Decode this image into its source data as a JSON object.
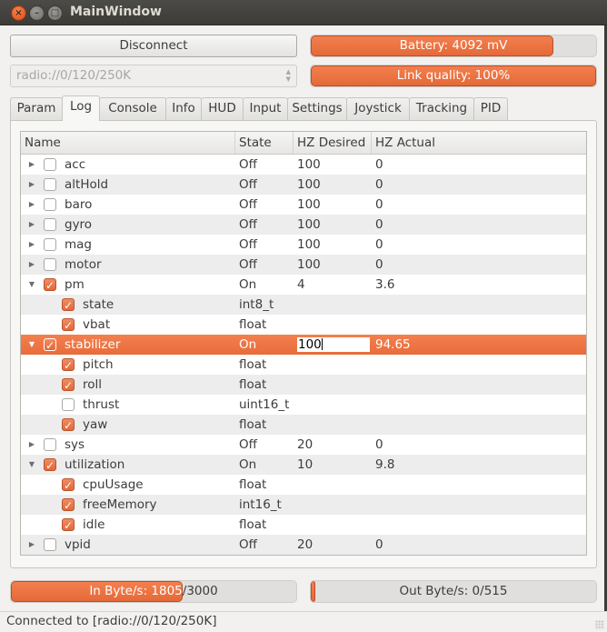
{
  "window": {
    "title": "MainWindow"
  },
  "toolbar": {
    "disconnect_label": "Disconnect",
    "uri_value": "radio://0/120/250K"
  },
  "battery": {
    "label": "Battery: 4092 mV",
    "fraction": 0.85
  },
  "link_quality": {
    "label": "Link quality: 100%",
    "fraction": 1.0
  },
  "tabs": [
    {
      "label": "Param",
      "active": false
    },
    {
      "label": "Log",
      "active": true
    },
    {
      "label": "Console",
      "active": false
    },
    {
      "label": "Info",
      "active": false
    },
    {
      "label": "HUD",
      "active": false
    },
    {
      "label": "Input",
      "active": false
    },
    {
      "label": "Settings",
      "active": false
    },
    {
      "label": "Joystick",
      "active": false
    },
    {
      "label": "Tracking",
      "active": false
    },
    {
      "label": "PID",
      "active": false
    }
  ],
  "log_tree": {
    "columns": [
      "Name",
      "State",
      "HZ Desired",
      "HZ Actual"
    ],
    "rows": [
      {
        "level": 0,
        "expander": "collapsed",
        "checked": false,
        "name": "acc",
        "state": "Off",
        "hz_desired": "100",
        "hz_actual": "0"
      },
      {
        "level": 0,
        "expander": "collapsed",
        "checked": false,
        "name": "altHold",
        "state": "Off",
        "hz_desired": "100",
        "hz_actual": "0"
      },
      {
        "level": 0,
        "expander": "collapsed",
        "checked": false,
        "name": "baro",
        "state": "Off",
        "hz_desired": "100",
        "hz_actual": "0"
      },
      {
        "level": 0,
        "expander": "collapsed",
        "checked": false,
        "name": "gyro",
        "state": "Off",
        "hz_desired": "100",
        "hz_actual": "0"
      },
      {
        "level": 0,
        "expander": "collapsed",
        "checked": false,
        "name": "mag",
        "state": "Off",
        "hz_desired": "100",
        "hz_actual": "0"
      },
      {
        "level": 0,
        "expander": "collapsed",
        "checked": false,
        "name": "motor",
        "state": "Off",
        "hz_desired": "100",
        "hz_actual": "0"
      },
      {
        "level": 0,
        "expander": "expanded",
        "checked": true,
        "name": "pm",
        "state": "On",
        "hz_desired": "4",
        "hz_actual": "3.6"
      },
      {
        "level": 1,
        "expander": "none",
        "checked": true,
        "name": "state",
        "state": "int8_t",
        "hz_desired": "",
        "hz_actual": ""
      },
      {
        "level": 1,
        "expander": "none",
        "checked": true,
        "name": "vbat",
        "state": "float",
        "hz_desired": "",
        "hz_actual": ""
      },
      {
        "level": 0,
        "expander": "expanded",
        "checked": true,
        "name": "stabilizer",
        "state": "On",
        "hz_desired": "100",
        "hz_actual": "94.65",
        "selected": true,
        "editing": true
      },
      {
        "level": 1,
        "expander": "none",
        "checked": true,
        "name": "pitch",
        "state": "float",
        "hz_desired": "",
        "hz_actual": ""
      },
      {
        "level": 1,
        "expander": "none",
        "checked": true,
        "name": "roll",
        "state": "float",
        "hz_desired": "",
        "hz_actual": ""
      },
      {
        "level": 1,
        "expander": "none",
        "checked": false,
        "name": "thrust",
        "state": "uint16_t",
        "hz_desired": "",
        "hz_actual": ""
      },
      {
        "level": 1,
        "expander": "none",
        "checked": true,
        "name": "yaw",
        "state": "float",
        "hz_desired": "",
        "hz_actual": ""
      },
      {
        "level": 0,
        "expander": "collapsed",
        "checked": false,
        "name": "sys",
        "state": "Off",
        "hz_desired": "20",
        "hz_actual": "0"
      },
      {
        "level": 0,
        "expander": "expanded",
        "checked": true,
        "name": "utilization",
        "state": "On",
        "hz_desired": "10",
        "hz_actual": "9.8"
      },
      {
        "level": 1,
        "expander": "none",
        "checked": true,
        "name": "cpuUsage",
        "state": "float",
        "hz_desired": "",
        "hz_actual": ""
      },
      {
        "level": 1,
        "expander": "none",
        "checked": true,
        "name": "freeMemory",
        "state": "int16_t",
        "hz_desired": "",
        "hz_actual": ""
      },
      {
        "level": 1,
        "expander": "none",
        "checked": true,
        "name": "idle",
        "state": "float",
        "hz_desired": "",
        "hz_actual": ""
      },
      {
        "level": 0,
        "expander": "collapsed",
        "checked": false,
        "name": "vpid",
        "state": "Off",
        "hz_desired": "20",
        "hz_actual": "0"
      }
    ]
  },
  "in_bytes": {
    "label": "In Byte/s: 1805/3000",
    "value": 1805,
    "max": 3000
  },
  "out_bytes": {
    "label": "Out Byte/s: 0/515",
    "value": 0,
    "max": 515
  },
  "status": {
    "text": "Connected to [radio://0/120/250K]"
  },
  "icons": {
    "close": "×",
    "minimize": "–",
    "maximize": "□",
    "expand_collapsed": "▶",
    "expand_expanded": "▼",
    "combo_arrows": "▲▼"
  },
  "colors": {
    "accent": "#e86c3b",
    "selection": "#f07746",
    "titlebar": "#3c3b37"
  }
}
